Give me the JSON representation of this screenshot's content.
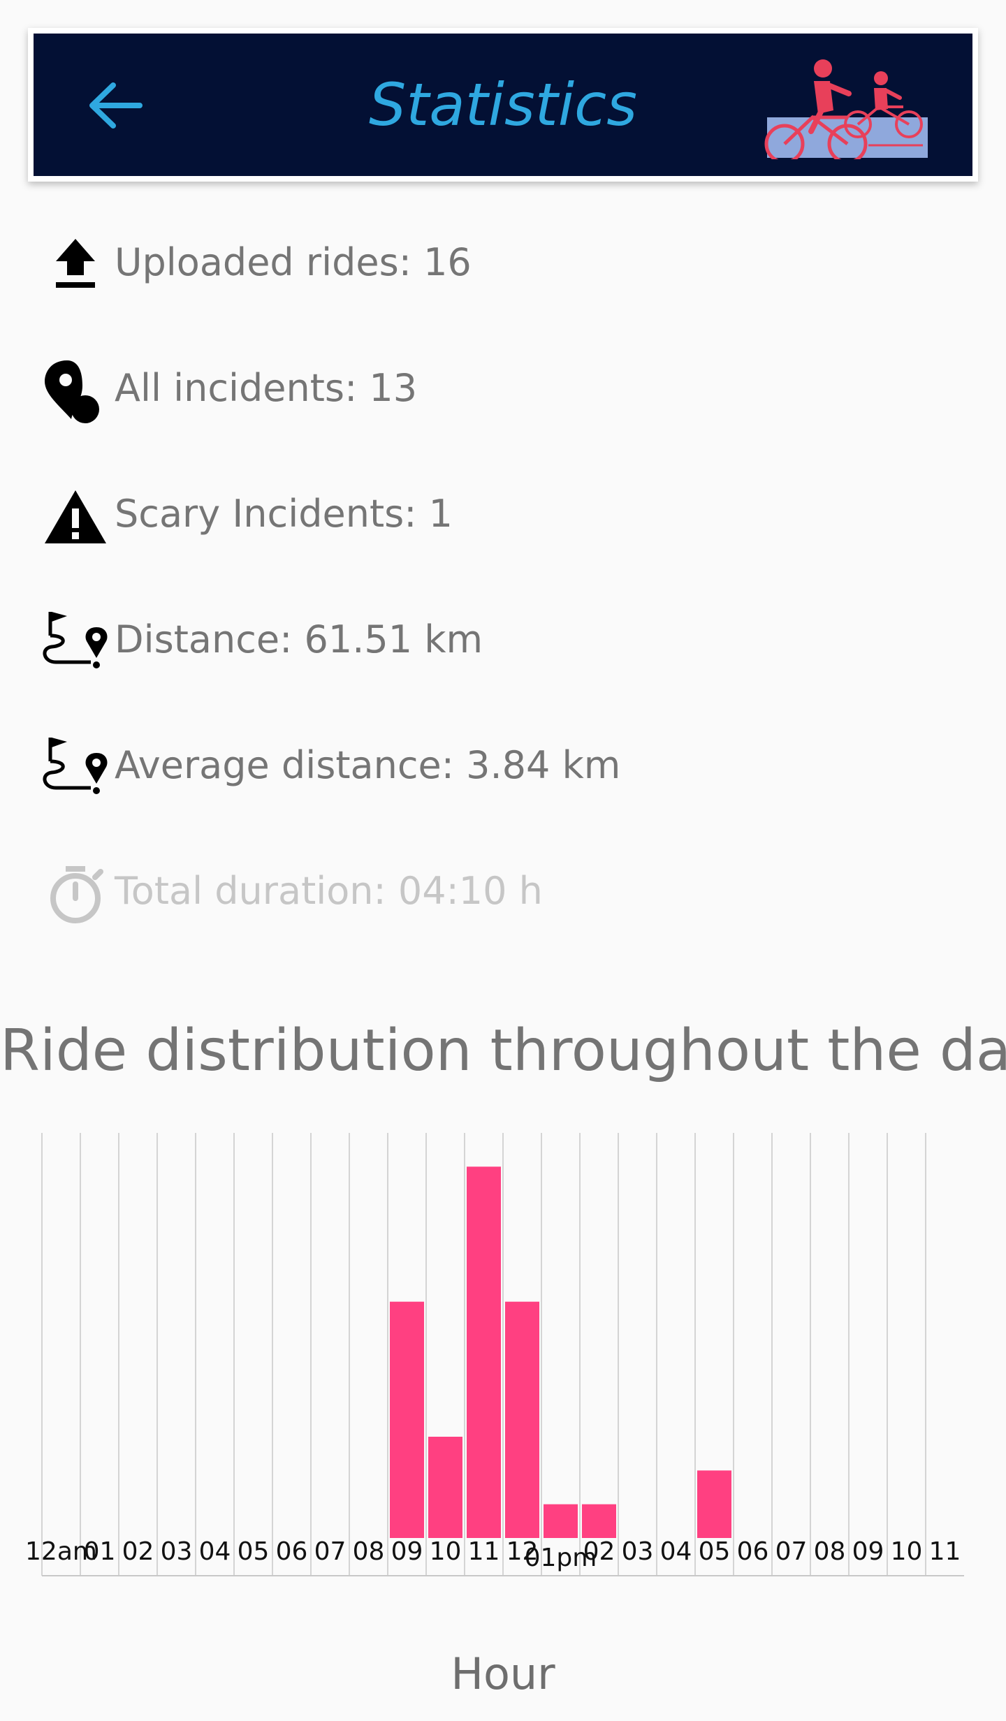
{
  "toolbar": {
    "title": "Statistics"
  },
  "stats": [
    {
      "icon": "upload-icon",
      "text": "Uploaded rides: 16"
    },
    {
      "icon": "incident-pin-icon",
      "text": "All incidents: 13"
    },
    {
      "icon": "warning-icon",
      "text": "Scary Incidents: 1"
    },
    {
      "icon": "route-icon",
      "text": "Distance: 61.51 km"
    },
    {
      "icon": "route-icon",
      "text": "Average distance: 3.84 km"
    },
    {
      "icon": "stopwatch-icon",
      "text": "Total duration: 04:10 h"
    }
  ],
  "colors": {
    "toolbar_bg": "#031034",
    "accent": "#2fa8e0",
    "bar": "#ff4081",
    "logo": "#e8405a"
  },
  "chart_data": {
    "type": "bar",
    "title": "Ride distribution throughout the day",
    "xlabel": "Hour",
    "ylabel": "",
    "grid": true,
    "categories": [
      "12am",
      "01",
      "02",
      "03",
      "04",
      "05",
      "06",
      "07",
      "08",
      "09",
      "10",
      "11",
      "12",
      "01pm",
      "02",
      "03",
      "04",
      "05",
      "06",
      "07",
      "08",
      "09",
      "10",
      "11"
    ],
    "values": [
      0,
      0,
      0,
      0,
      0,
      0,
      0,
      0,
      0,
      7,
      3,
      11,
      7,
      1,
      1,
      0,
      0,
      2,
      0,
      0,
      0,
      0,
      0,
      0
    ],
    "ylim": [
      0,
      12
    ]
  }
}
